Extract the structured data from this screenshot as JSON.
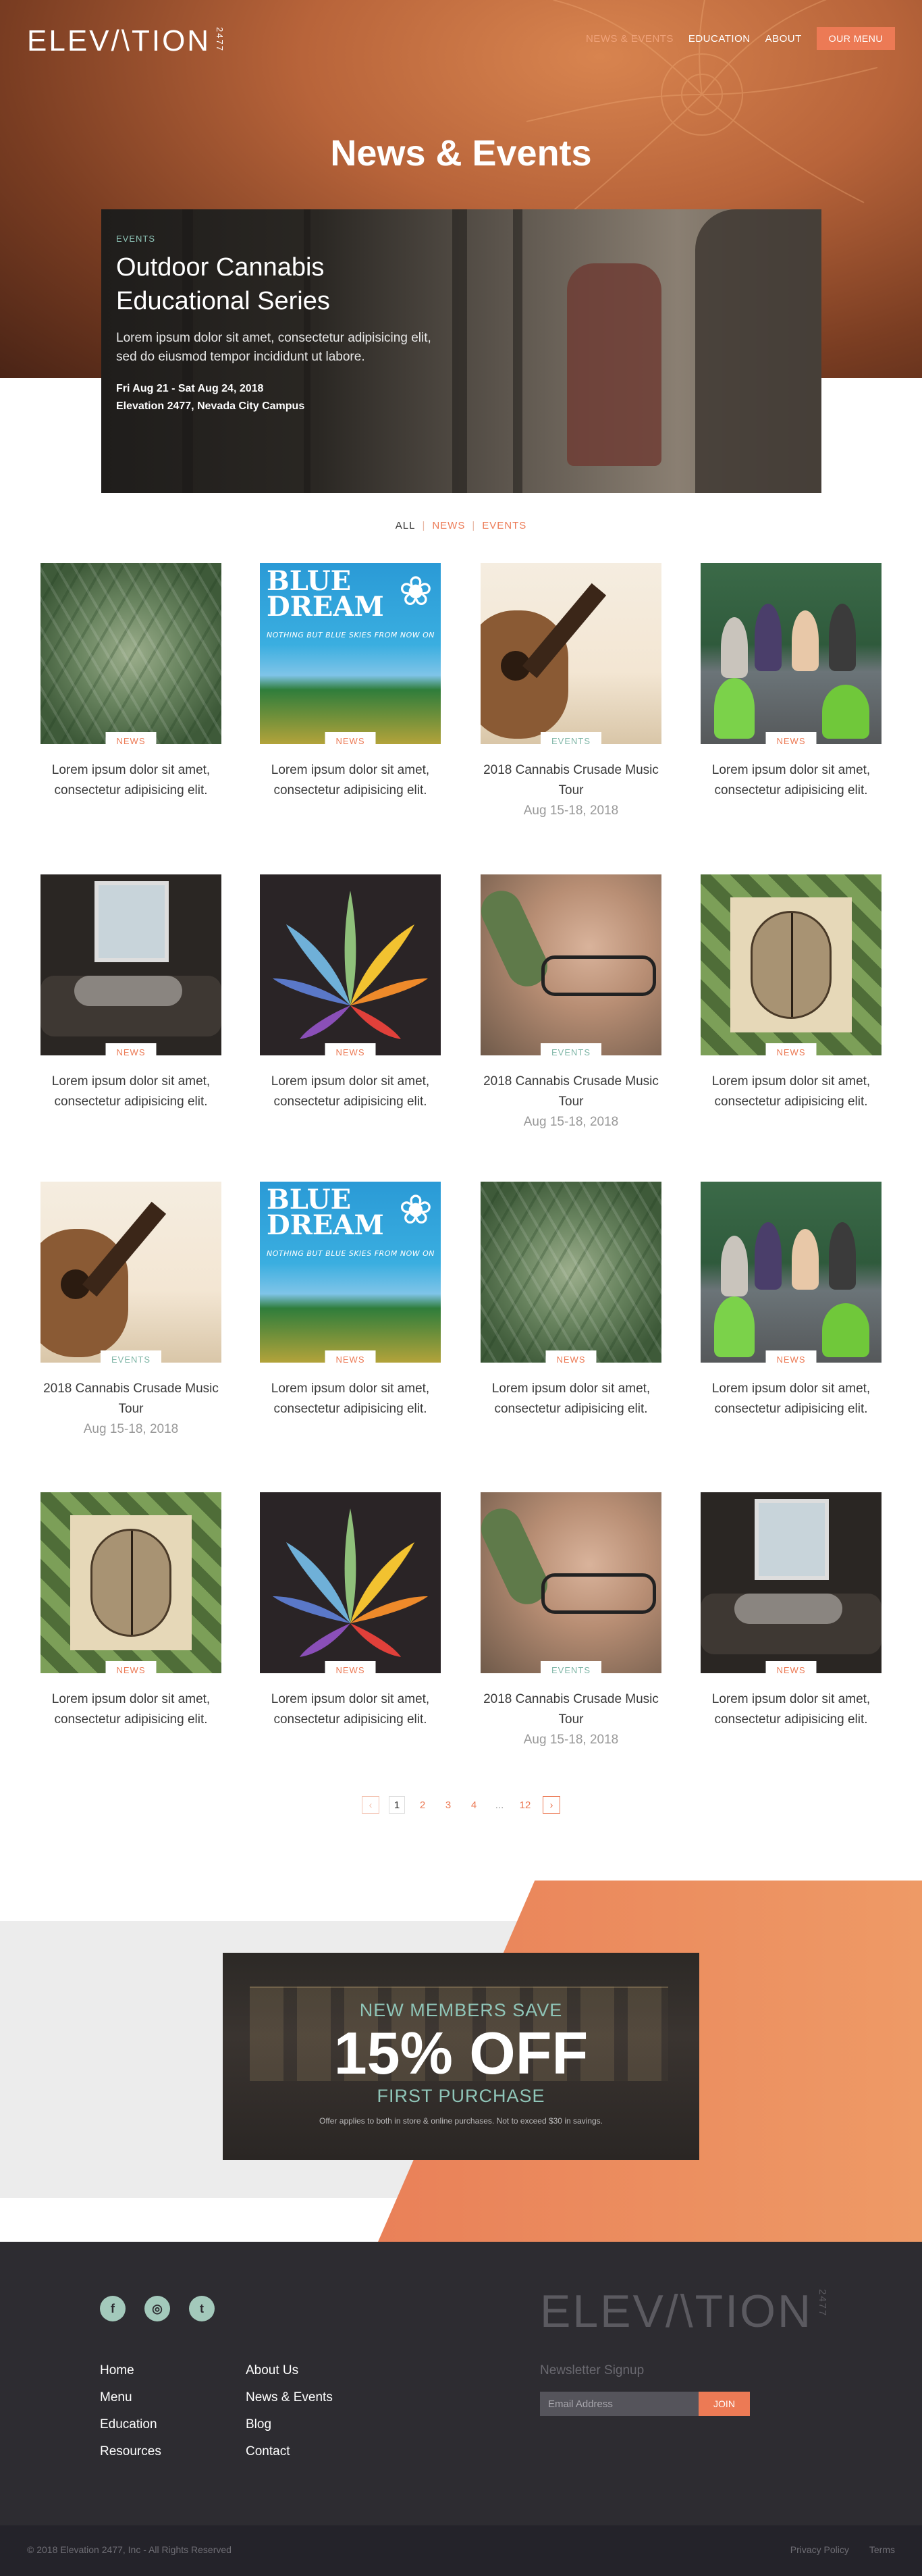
{
  "brand": {
    "logo": "ELEV/\\TION",
    "logo_sub": "2477"
  },
  "nav": {
    "items": [
      "NEWS & EVENTS",
      "EDUCATION",
      "ABOUT"
    ],
    "menu_button": "OUR MENU"
  },
  "page_title": "News & Events",
  "feature": {
    "tag": "EVENTS",
    "title": "Outdoor Cannabis Educational Series",
    "body": "Lorem ipsum dolor sit amet, consectetur adipisicing elit, sed do eiusmod tempor incididunt ut labore.",
    "date": "Fri Aug 21 - Sat Aug 24, 2018",
    "location": "Elevation 2477, Nevada City Campus"
  },
  "filters": {
    "all": "ALL",
    "news": "NEWS",
    "events": "EVENTS"
  },
  "cards": [
    {
      "type": "plant",
      "badge": "NEWS",
      "title": "Lorem ipsum dolor sit amet, consectetur adipisicing elit.",
      "date": ""
    },
    {
      "type": "blue",
      "badge": "NEWS",
      "title": "Lorem ipsum dolor sit amet, consectetur adipisicing elit.",
      "date": ""
    },
    {
      "type": "guitar",
      "badge": "EVENTS",
      "title": "2018 Cannabis Crusade Music Tour",
      "date": "Aug 15-18, 2018"
    },
    {
      "type": "party",
      "badge": "NEWS",
      "title": "Lorem ipsum dolor sit amet, consectetur adipisicing elit.",
      "date": ""
    },
    {
      "type": "window",
      "badge": "NEWS",
      "title": "Lorem ipsum dolor sit amet, consectetur adipisicing elit.",
      "date": ""
    },
    {
      "type": "leaf",
      "badge": "NEWS",
      "title": "Lorem ipsum dolor sit amet, consectetur adipisicing elit.",
      "date": ""
    },
    {
      "type": "face",
      "badge": "EVENTS",
      "title": "2018 Cannabis Crusade Music Tour",
      "date": "Aug 15-18, 2018"
    },
    {
      "type": "brain",
      "badge": "NEWS",
      "title": "Lorem ipsum dolor sit amet, consectetur adipisicing elit.",
      "date": ""
    },
    {
      "type": "guitar",
      "badge": "EVENTS",
      "title": "2018 Cannabis Crusade Music Tour",
      "date": "Aug 15-18, 2018"
    },
    {
      "type": "blue",
      "badge": "NEWS",
      "title": "Lorem ipsum dolor sit amet, consectetur adipisicing elit.",
      "date": ""
    },
    {
      "type": "plant",
      "badge": "NEWS",
      "title": "Lorem ipsum dolor sit amet, consectetur adipisicing elit.",
      "date": ""
    },
    {
      "type": "party",
      "badge": "NEWS",
      "title": "Lorem ipsum dolor sit amet, consectetur adipisicing elit.",
      "date": ""
    },
    {
      "type": "brain",
      "badge": "NEWS",
      "title": "Lorem ipsum dolor sit amet, consectetur adipisicing elit.",
      "date": ""
    },
    {
      "type": "leaf",
      "badge": "NEWS",
      "title": "Lorem ipsum dolor sit amet, consectetur adipisicing elit.",
      "date": ""
    },
    {
      "type": "face",
      "badge": "EVENTS",
      "title": "2018 Cannabis Crusade Music Tour",
      "date": "Aug 15-18, 2018"
    },
    {
      "type": "window",
      "badge": "NEWS",
      "title": "Lorem ipsum dolor sit amet, consectetur adipisicing elit.",
      "date": ""
    }
  ],
  "blue_dream": {
    "title": "BLUE DREAM",
    "subtitle": "NOTHING BUT BLUE SKIES FROM NOW ON"
  },
  "pagination": {
    "prev": "‹",
    "pages": [
      "1",
      "2",
      "3",
      "4"
    ],
    "dots": "...",
    "last": "12",
    "next": "›",
    "current": "1"
  },
  "promo": {
    "line1": "NEW MEMBERS SAVE",
    "line2": "15% OFF",
    "line3": "FIRST PURCHASE",
    "fine_print": "Offer applies to both in store & online purchases. Not to exceed $30 in savings."
  },
  "footer": {
    "social": [
      {
        "name": "facebook",
        "glyph": "f"
      },
      {
        "name": "instagram",
        "glyph": "◎"
      },
      {
        "name": "twitter",
        "glyph": "t"
      }
    ],
    "col1": [
      "Home",
      "Menu",
      "Education",
      "Resources"
    ],
    "col2": [
      "About Us",
      "News & Events",
      "Blog",
      "Contact"
    ],
    "newsletter_label": "Newsletter Signup",
    "email_placeholder": "Email Address",
    "join": "JOIN",
    "copyright": "© 2018 Elevation 2477, Inc - All Rights Reserved",
    "legal": [
      "Privacy Policy",
      "Terms"
    ]
  },
  "colors": {
    "accent": "#ec7a55",
    "teal": "#7fb6a7",
    "footer_bg": "#2d2c31"
  }
}
